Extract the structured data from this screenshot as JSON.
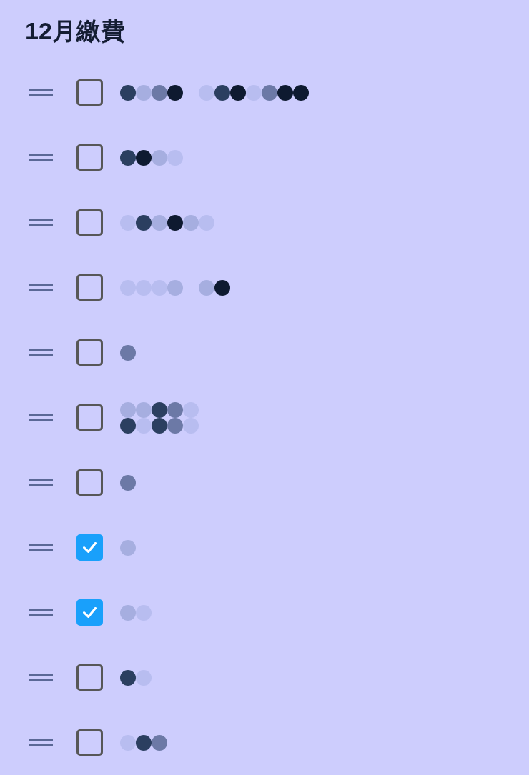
{
  "title": "12月繳費",
  "items": [
    {
      "checked": false
    },
    {
      "checked": false
    },
    {
      "checked": false
    },
    {
      "checked": false
    },
    {
      "checked": false
    },
    {
      "checked": false
    },
    {
      "checked": false
    },
    {
      "checked": true
    },
    {
      "checked": true
    },
    {
      "checked": false
    },
    {
      "checked": false
    }
  ]
}
